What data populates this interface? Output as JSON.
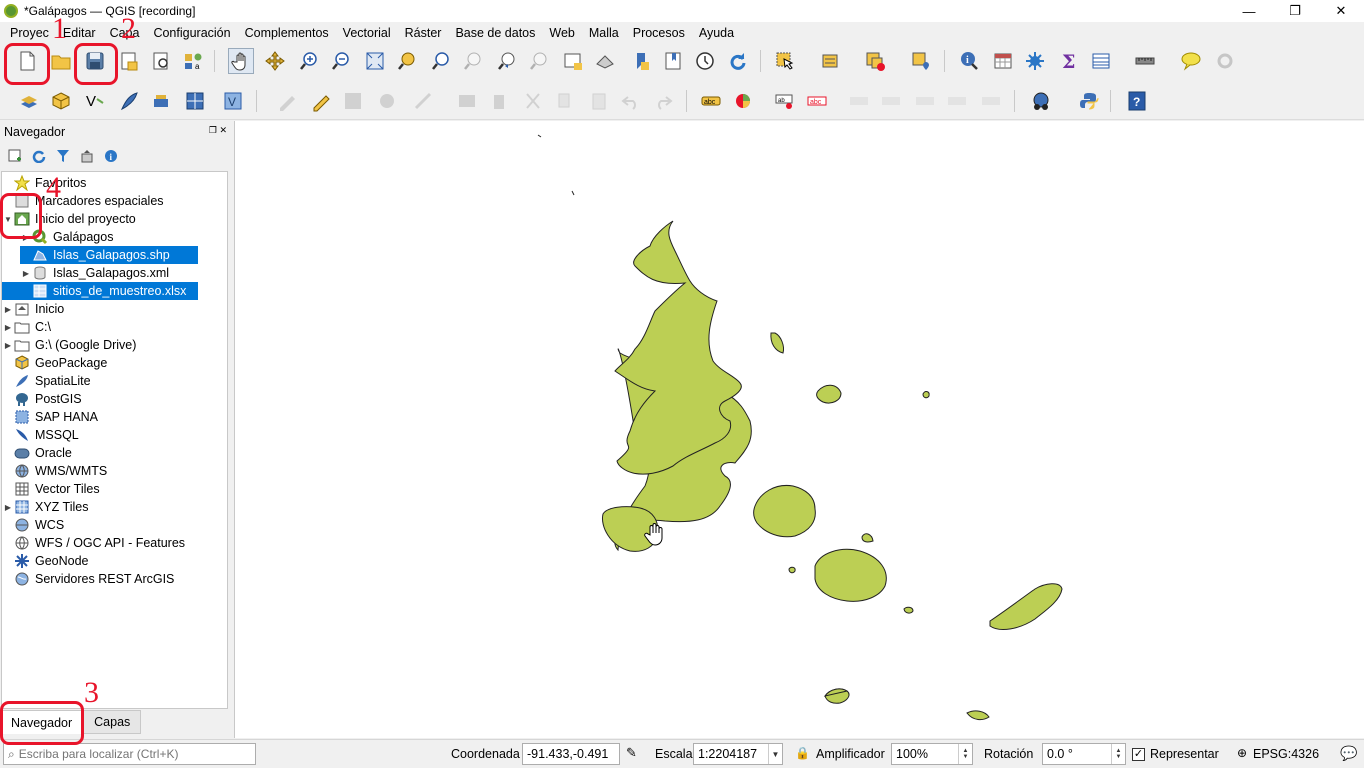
{
  "window": {
    "title": "*Galápagos — QGIS [recording]",
    "controls": [
      "—",
      "❐",
      "✕"
    ]
  },
  "menu": [
    "Proyec",
    "Editar",
    "Capa",
    "Configuración",
    "Complementos",
    "Vectorial",
    "Ráster",
    "Base de datos",
    "Web",
    "Malla",
    "Procesos",
    "Ayuda"
  ],
  "browser": {
    "title": "Navegador",
    "items": [
      {
        "label": "Favoritos",
        "icon": "star-icon"
      },
      {
        "label": "Marcadores espaciales",
        "icon": "bookmark-icon"
      },
      {
        "label": "Inicio del proyecto",
        "icon": "project-home-icon"
      },
      {
        "label": "Galápagos",
        "icon": "qgis-project-icon"
      },
      {
        "label": "Islas_Galapagos.shp",
        "icon": "vector-layer-icon"
      },
      {
        "label": "Islas_Galapagos.xml",
        "icon": "database-icon"
      },
      {
        "label": "sitios_de_muestreo.xlsx",
        "icon": "table-icon"
      },
      {
        "label": "Inicio",
        "icon": "home-folder-icon"
      },
      {
        "label": "C:\\",
        "icon": "folder-icon"
      },
      {
        "label": "G:\\ (Google Drive)",
        "icon": "folder-icon"
      },
      {
        "label": "GeoPackage",
        "icon": "geopackage-icon"
      },
      {
        "label": "SpatiaLite",
        "icon": "spatialite-icon"
      },
      {
        "label": "PostGIS",
        "icon": "postgis-icon"
      },
      {
        "label": "SAP HANA",
        "icon": "sap-hana-icon"
      },
      {
        "label": "MSSQL",
        "icon": "mssql-icon"
      },
      {
        "label": "Oracle",
        "icon": "oracle-icon"
      },
      {
        "label": "WMS/WMTS",
        "icon": "wms-icon"
      },
      {
        "label": "Vector Tiles",
        "icon": "vector-tiles-icon"
      },
      {
        "label": "XYZ Tiles",
        "icon": "xyz-tiles-icon"
      },
      {
        "label": "WCS",
        "icon": "wcs-icon"
      },
      {
        "label": "WFS / OGC API - Features",
        "icon": "wfs-icon"
      },
      {
        "label": "GeoNode",
        "icon": "geonode-icon"
      },
      {
        "label": "Servidores REST ArcGIS",
        "icon": "arcgis-rest-icon"
      }
    ]
  },
  "tabs": {
    "navegador": "Navegador",
    "capas": "Capas"
  },
  "status": {
    "search_placeholder": "Escriba para localizar (Ctrl+K)",
    "coord_label": "Coordenada",
    "coord_value": "-91.433,-0.491",
    "scale_label": "Escala",
    "scale_value": "1:2204187",
    "magnifier_label": "Amplificador",
    "magnifier_value": "100%",
    "rotation_label": "Rotación",
    "rotation_value": "0.0 °",
    "render_label": "Representar",
    "crs": "EPSG:4326"
  },
  "annotations": [
    "1",
    "2",
    "3",
    "4"
  ],
  "colors": {
    "island_fill": "#bccf54",
    "selection": "#0078d7",
    "annotation": "#e8142a"
  }
}
